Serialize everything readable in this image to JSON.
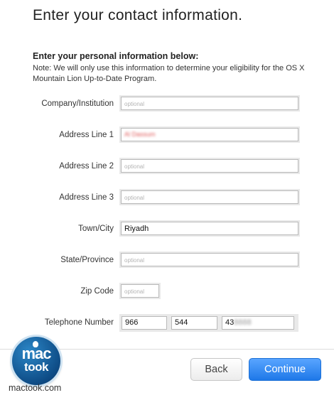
{
  "page_title": "Enter your contact information.",
  "section": {
    "heading": "Enter your personal information below:",
    "note": "Note: We will only use this information to determine your eligibility for the OS X Mountain Lion Up-to-Date Program."
  },
  "fields": {
    "company": {
      "label": "Company/Institution",
      "placeholder": "optional",
      "value": ""
    },
    "address1": {
      "label": "Address Line 1",
      "value": "Al Dassum"
    },
    "address2": {
      "label": "Address Line 2",
      "placeholder": "optional",
      "value": ""
    },
    "address3": {
      "label": "Address Line 3",
      "placeholder": "optional",
      "value": ""
    },
    "town": {
      "label": "Town/City",
      "value": "Riyadh"
    },
    "state": {
      "label": "State/Province",
      "placeholder": "optional",
      "value": ""
    },
    "zip": {
      "label": "Zip Code",
      "placeholder": "optional",
      "value": ""
    },
    "telephone": {
      "label": "Telephone Number",
      "country_code": "966",
      "area_code": "544",
      "number_visible": "43",
      "number_hidden": "8888"
    }
  },
  "buttons": {
    "back": "Back",
    "continue": "Continue"
  },
  "watermark": {
    "line1": "mac",
    "line2": "took",
    "caption": "mactook.com"
  },
  "colors": {
    "accent": "#1e78e8",
    "border": "#b9b9b9"
  }
}
